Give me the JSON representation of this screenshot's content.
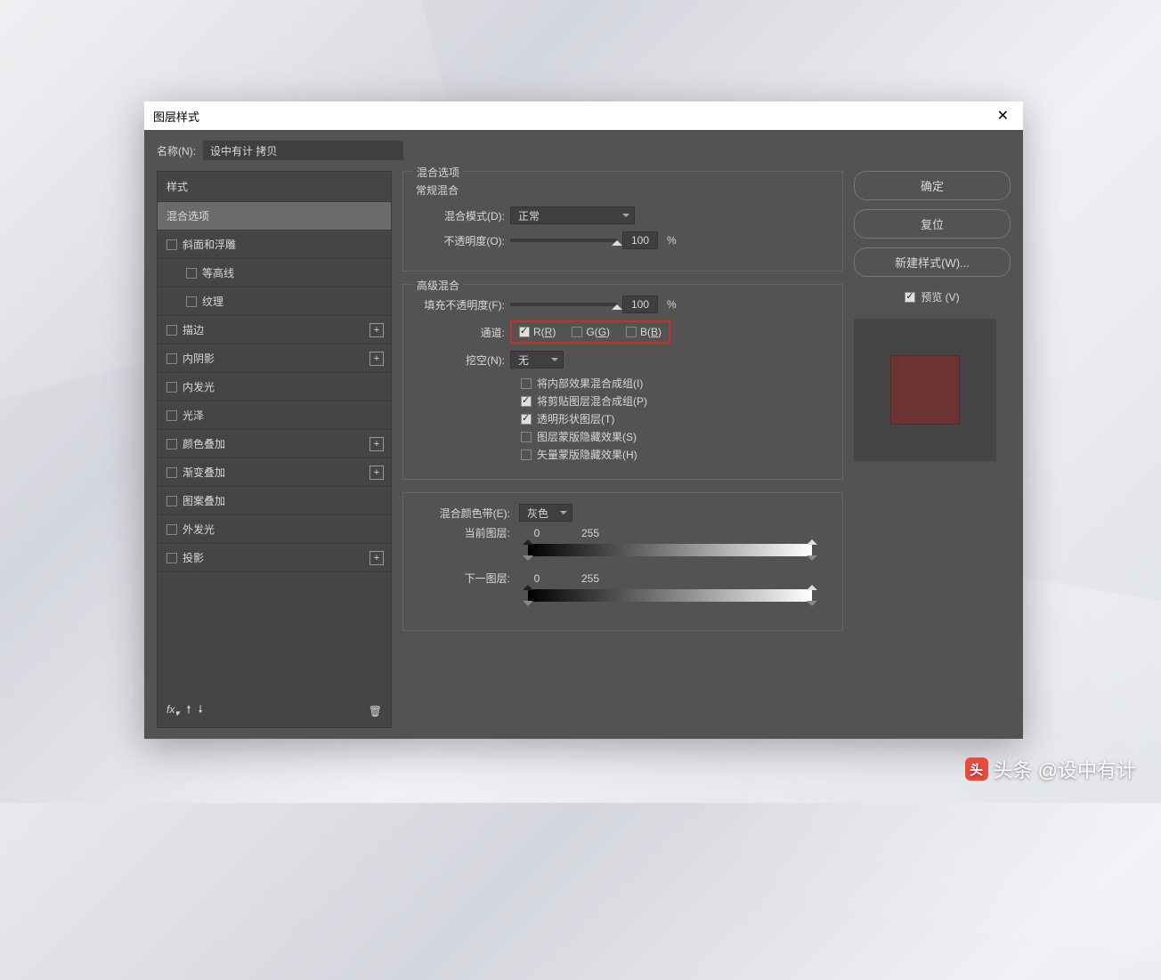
{
  "dialog": {
    "title": "图层样式",
    "name_label": "名称(N):",
    "name_value": "设中有计 拷贝"
  },
  "styles": {
    "header": "样式",
    "blend_options": "混合选项",
    "items": [
      {
        "label": "斜面和浮雕",
        "add": false
      },
      {
        "label": "等高线",
        "sub": true
      },
      {
        "label": "纹理",
        "sub": true
      },
      {
        "label": "描边",
        "add": true
      },
      {
        "label": "内阴影",
        "add": true
      },
      {
        "label": "内发光"
      },
      {
        "label": "光泽"
      },
      {
        "label": "颜色叠加",
        "add": true
      },
      {
        "label": "渐变叠加",
        "add": true
      },
      {
        "label": "图案叠加"
      },
      {
        "label": "外发光"
      },
      {
        "label": "投影",
        "add": true
      }
    ],
    "fx": "fx"
  },
  "blend": {
    "section_title": "混合选项",
    "general_title": "常规混合",
    "mode_label": "混合模式(D):",
    "mode_value": "正常",
    "opacity_label": "不透明度(O):",
    "opacity_value": "100",
    "pct": "%",
    "adv_title": "高级混合",
    "fill_label": "填充不透明度(F):",
    "fill_value": "100",
    "channel_label": "通道:",
    "ch_r": "R(R)",
    "ch_g": "G(G)",
    "ch_b": "B(B)",
    "knockout_label": "挖空(N):",
    "knockout_value": "无",
    "adv1": "将内部效果混合成组(I)",
    "adv2": "将剪贴图层混合成组(P)",
    "adv3": "透明形状图层(T)",
    "adv4": "图层蒙版隐藏效果(S)",
    "adv5": "矢量蒙版隐藏效果(H)",
    "blendif_label": "混合颜色带(E):",
    "blendif_value": "灰色",
    "this_layer": "当前图层:",
    "this_lo": "0",
    "this_hi": "255",
    "under_layer": "下一图层:",
    "under_lo": "0",
    "under_hi": "255"
  },
  "buttons": {
    "ok": "确定",
    "reset": "复位",
    "new_style": "新建样式(W)...",
    "preview": "预览 (V)"
  },
  "watermark": "头条 @设中有计"
}
